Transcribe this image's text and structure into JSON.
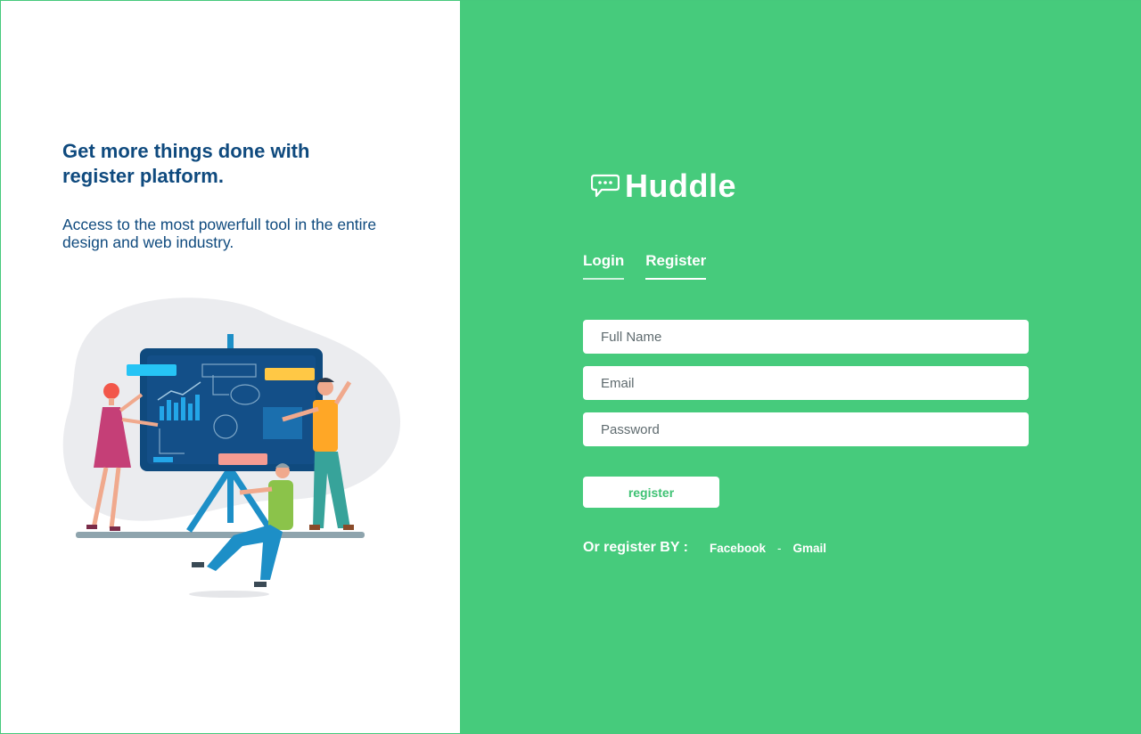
{
  "left_panel": {
    "headline": "Get more things done with register platform.",
    "subtext": "Access to the most powerfull tool in the entire design and web industry."
  },
  "brand": {
    "name": "Huddle",
    "icon": "chat-bubble-icon"
  },
  "tabs": [
    {
      "label": "Login"
    },
    {
      "label": "Register"
    }
  ],
  "form": {
    "full_name_placeholder": "Full Name",
    "email_placeholder": "Email",
    "password_placeholder": "Password",
    "submit_label": "register"
  },
  "social": {
    "label": "Or register BY :",
    "facebook": "Facebook",
    "separator": "-",
    "gmail": "Gmail"
  },
  "colors": {
    "accent": "#46cb7c",
    "heading": "#0f4a7e"
  }
}
